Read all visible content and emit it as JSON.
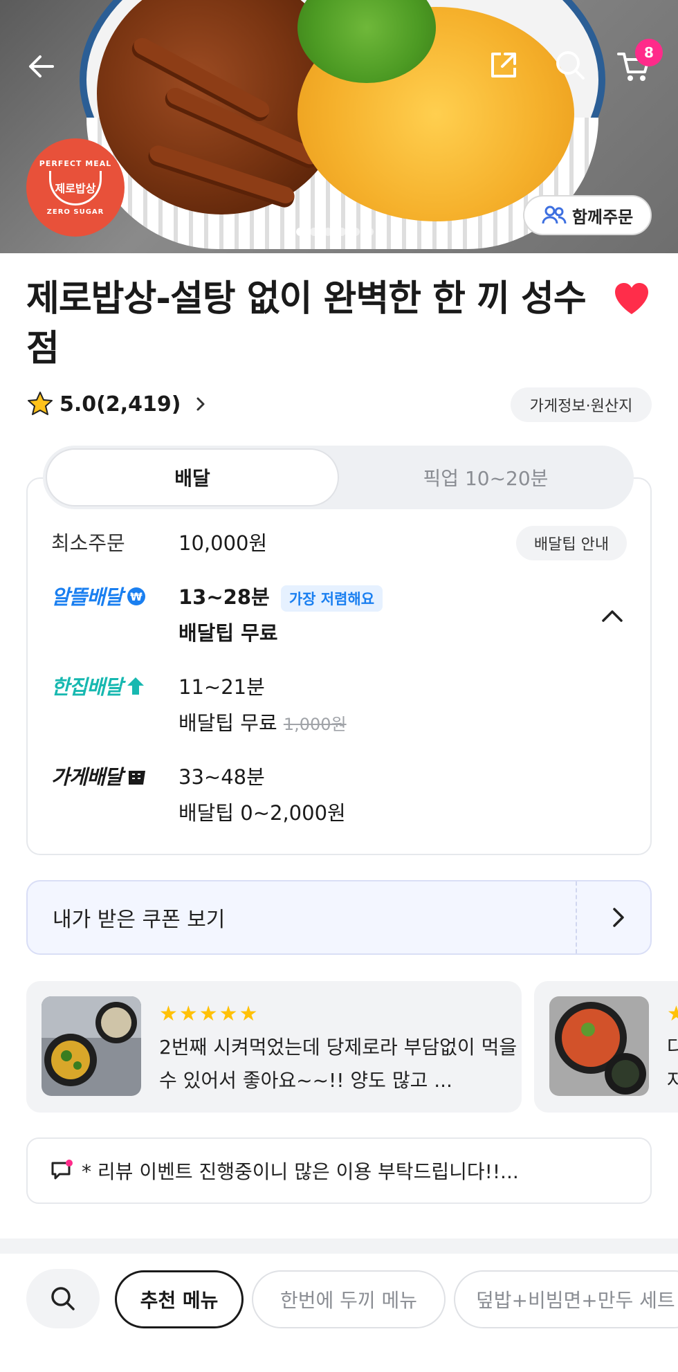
{
  "header": {
    "cart_count": "8",
    "group_order_label": "함께주문",
    "carousel_total": 6,
    "carousel_active": 0
  },
  "logo": {
    "top_text": "PERFECT MEAL",
    "name": "제로밥상",
    "bottom_text": "ZERO SUGAR"
  },
  "store": {
    "title": "제로밥상-설탕 없이 완벽한 한 끼 성수점",
    "rating": "5.0(2,419)",
    "info_label": "가게정보·원산지",
    "favorited": true
  },
  "mode_tabs": {
    "delivery": "배달",
    "pickup": "픽업  10~20분"
  },
  "delivery": {
    "min_order_label": "최소주문",
    "min_order_value": "10,000원",
    "tip_guide_label": "배달팁 안내",
    "options": [
      {
        "brand": "알뜰배달",
        "time": "13~28분",
        "badge": "가장 저렴해요",
        "tip": "배달팁 무료",
        "original": ""
      },
      {
        "brand": "한집배달",
        "time": "11~21분",
        "badge": "",
        "tip": "배달팁 무료",
        "original": "1,000원"
      },
      {
        "brand": "가게배달",
        "time": "33~48분",
        "badge": "",
        "tip": "배달팁 0~2,000원",
        "original": ""
      }
    ]
  },
  "coupon": {
    "label": "내가 받은 쿠폰 보기"
  },
  "reviews": [
    {
      "stars": "★★★★★",
      "text": "2번째 시켜먹었는데 당제로라 부담없이 먹을 수 있어서 좋아요~~!! 양도 많고 ..."
    },
    {
      "stars": "★",
      "text": "다 자"
    }
  ],
  "notice": {
    "text": "* 리뷰 이벤트 진행중이니 많은 이용 부탁드립니다!!..."
  },
  "menu_tabs": [
    {
      "label": "추천 메뉴",
      "active": true
    },
    {
      "label": "한번에 두끼 메뉴",
      "active": false
    },
    {
      "label": "덮밥+비빔면+만두 세트",
      "active": false
    }
  ],
  "colors": {
    "accent_blue": "#1a7ff0",
    "accent_teal": "#17b8b0",
    "heart": "#ff2d4a",
    "badge_pink": "#ff2b8a",
    "logo_red": "#e8513a"
  }
}
